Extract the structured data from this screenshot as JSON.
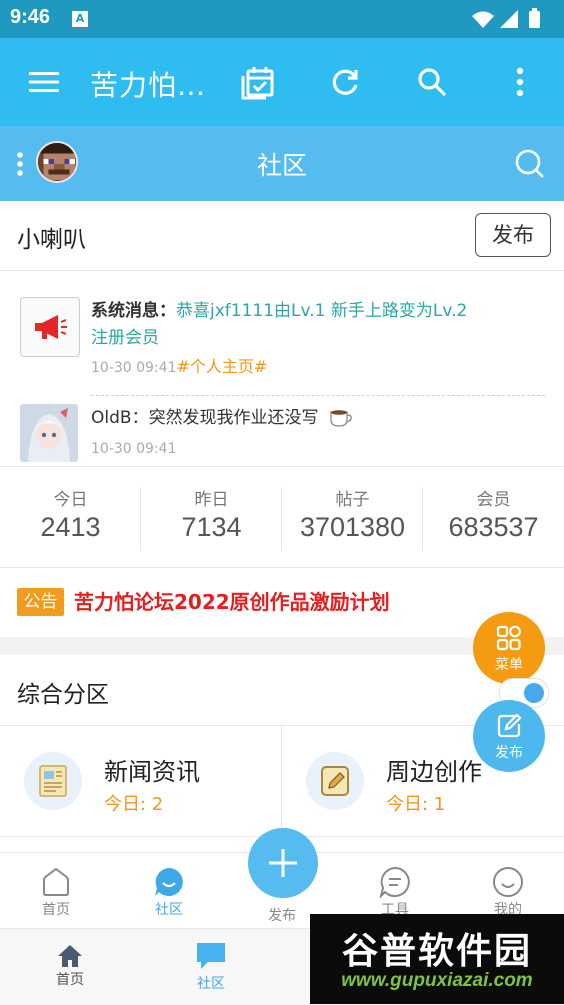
{
  "status_bar": {
    "time": "9:46",
    "notification_icon": "A"
  },
  "toolbar": {
    "title": "苦力怕…",
    "icons": [
      "menu-icon",
      "calendar-check-icon",
      "refresh-icon",
      "search-icon",
      "more-vert-icon"
    ]
  },
  "community_header": {
    "title": "社区"
  },
  "notice": {
    "section_title": "小喇叭",
    "publish_label": "发布",
    "system_message": {
      "prefix": "系统消息：",
      "text_line1": "恭喜jxf1111由Lv.1 新手上路变为Lv.2",
      "text_line2": "注册会员",
      "time": "10-30 09:41",
      "link": "#个人主页#"
    },
    "user_message": {
      "user": "OldB",
      "sep": "：",
      "text": "突然发现我作业还没写",
      "time": "10-30 09:41"
    }
  },
  "stats": [
    {
      "label": "今日",
      "value": "2413"
    },
    {
      "label": "昨日",
      "value": "7134"
    },
    {
      "label": "帖子",
      "value": "3701380"
    },
    {
      "label": "会员",
      "value": "683537"
    }
  ],
  "announcement": {
    "badge": "公告",
    "text": "苦力怕论坛2022原创作品激励计划"
  },
  "floating": {
    "menu_label": "菜单",
    "publish_label": "发布"
  },
  "category": {
    "title": "综合分区",
    "forums": [
      {
        "name": "新闻资讯",
        "today": "今日: 2"
      },
      {
        "name": "周边创作",
        "today": "今日: 1"
      }
    ]
  },
  "bottom_nav": {
    "items": [
      {
        "label": "首页"
      },
      {
        "label": "社区"
      },
      {
        "label": "发布"
      },
      {
        "label": "工具"
      },
      {
        "label": "我的"
      }
    ]
  },
  "outer_nav": {
    "items": [
      {
        "label": "首页"
      },
      {
        "label": "社区"
      }
    ]
  },
  "watermark": {
    "title": "谷普软件园",
    "url": "www.gupuxiazai.com"
  },
  "colors": {
    "status_bar": "#1f99bf",
    "toolbar": "#2ebcf1",
    "community": "#56bbef",
    "accent_orange": "#f3961a",
    "accent_teal": "#2aa7a6",
    "announcement_red": "#e41f1f"
  }
}
